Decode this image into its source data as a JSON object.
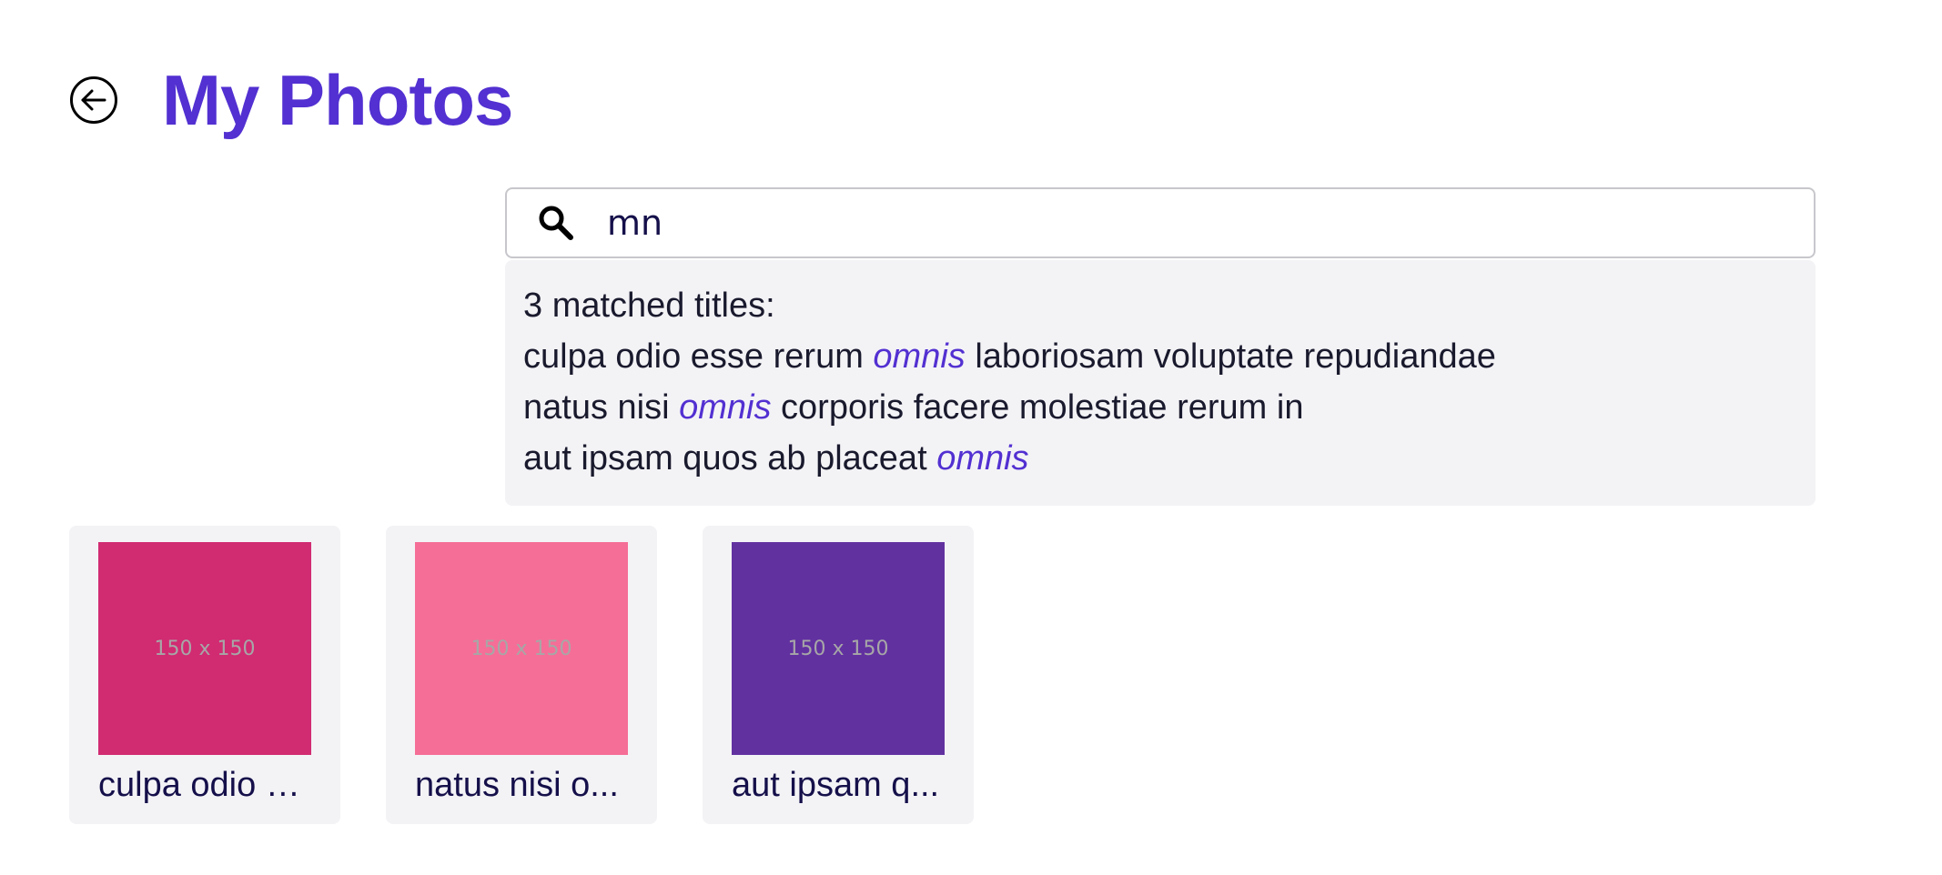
{
  "header": {
    "title": "My Photos",
    "back_icon": "arrow-left-circle-icon"
  },
  "search": {
    "icon": "search-icon",
    "value": "mn",
    "placeholder": ""
  },
  "results": {
    "summary": "3 matched titles:",
    "matches": [
      {
        "before": "culpa odio esse rerum ",
        "highlight": "omnis",
        "after": " laboriosam voluptate repudiandae"
      },
      {
        "before": "natus nisi ",
        "highlight": "omnis",
        "after": " corporis facere molestiae rerum in"
      },
      {
        "before": "aut ipsam quos ab placeat ",
        "highlight": "omnis",
        "after": ""
      }
    ],
    "highlight_color": "#5230d1"
  },
  "photos": [
    {
      "thumb_text": "150 x 150",
      "color": "#d12b72",
      "title": "culpa odio e..."
    },
    {
      "thumb_text": "150 x 150",
      "color": "#f56e97",
      "title": "natus nisi o..."
    },
    {
      "thumb_text": "150 x 150",
      "color": "#6231a0",
      "title": "aut ipsam q..."
    }
  ],
  "colors": {
    "accent": "#5230d1",
    "panel_bg": "#f3f3f6"
  }
}
